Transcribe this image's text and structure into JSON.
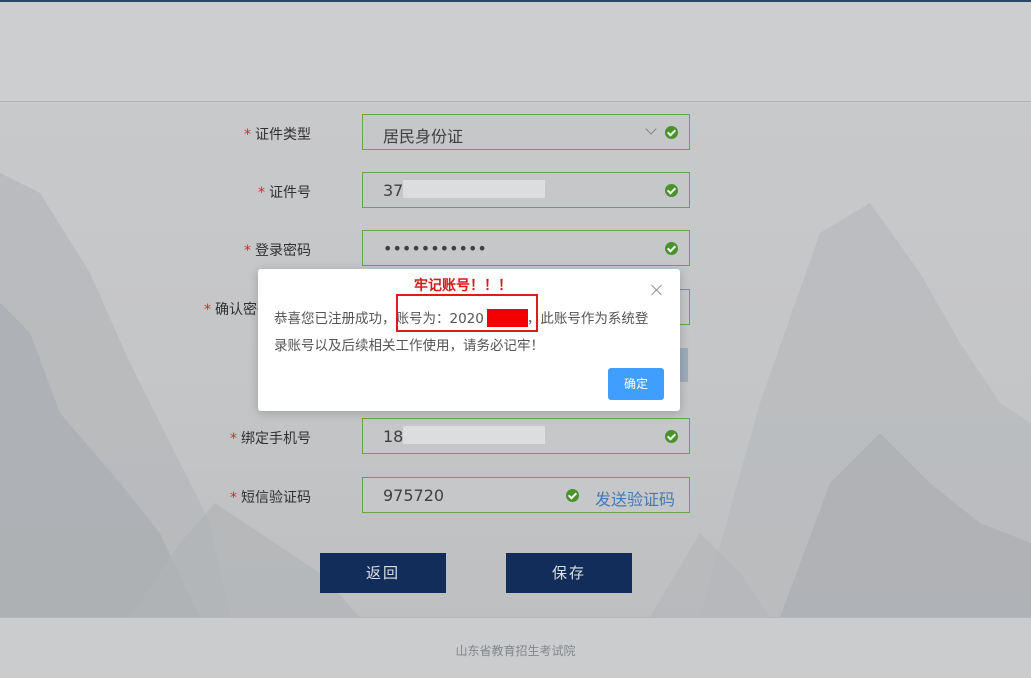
{
  "form": {
    "id_type": {
      "label": "证件类型",
      "value": "居民身份证"
    },
    "id_number": {
      "label": "证件号",
      "value": "37"
    },
    "password": {
      "label": "登录密码",
      "value": "•••••••••••"
    },
    "confirm_password": {
      "label": "确认密码"
    },
    "phone": {
      "label": "绑定手机号",
      "value": "18"
    },
    "sms_code": {
      "label": "短信验证码",
      "value": "975720",
      "send_link": "发送验证码"
    },
    "required_mark": "*"
  },
  "buttons": {
    "back": "返回",
    "save": "保存"
  },
  "footer": {
    "text": "山东省教育招生考试院"
  },
  "dialog": {
    "title": "牢记账号！！！",
    "line1": "恭喜您已注册成功，账号为：2020",
    "line1b": "，此账号作为系统登",
    "line2": "录账号以及后续相关工作使用，请务必记牢！",
    "ok_label": "确定"
  },
  "colors": {
    "valid": "#4f9a2f",
    "primary": "#14305e",
    "alert": "#d01c1c",
    "ok_button": "#409eff"
  }
}
